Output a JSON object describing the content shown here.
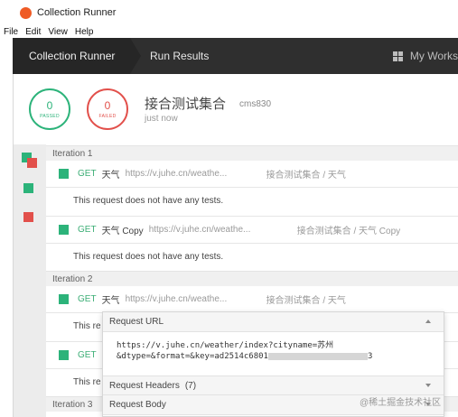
{
  "window": {
    "title": "Collection Runner"
  },
  "menu": [
    "File",
    "Edit",
    "View",
    "Help"
  ],
  "nav": {
    "tab1": "Collection Runner",
    "tab2": "Run Results",
    "workspace": "My Works"
  },
  "summary": {
    "passed_count": "0",
    "passed_label": "PASSED",
    "failed_count": "0",
    "failed_label": "FAILED",
    "collection_name": "接合测试集合",
    "tag": "cms830",
    "time": "just now"
  },
  "iterations": [
    "Iteration 1",
    "Iteration 2",
    "Iteration 3"
  ],
  "requests": [
    {
      "method": "GET",
      "name": "天气",
      "url": "https://v.juhe.cn/weathe...",
      "path": "接合测试集合 / 天气"
    },
    {
      "method": "GET",
      "name": "天气 Copy",
      "url": "https://v.juhe.cn/weathe...",
      "path": "接合测试集合 / 天气 Copy"
    },
    {
      "method": "GET",
      "name": "天气",
      "url": "https://v.juhe.cn/weathe...",
      "path": "接合测试集合 / 天气"
    },
    {
      "method": "GET",
      "name": ""
    }
  ],
  "no_tests_text": "This request does not have any tests.",
  "truncated_note": "This re",
  "popup": {
    "url_header": "Request URL",
    "url_line1": "https://v.juhe.cn/weather/index?cityname=苏州",
    "url_line2a": "&dtype=&format=&key=ad2514c6801",
    "url_line2b": "3",
    "headers_label": "Request Headers",
    "headers_count": "(7)",
    "body_label": "Request Body"
  },
  "watermark": "@稀土掘金技术社区",
  "colors": {
    "pass": "#2cb37a",
    "fail": "#e2504b",
    "nav": "#2f2f2f"
  }
}
